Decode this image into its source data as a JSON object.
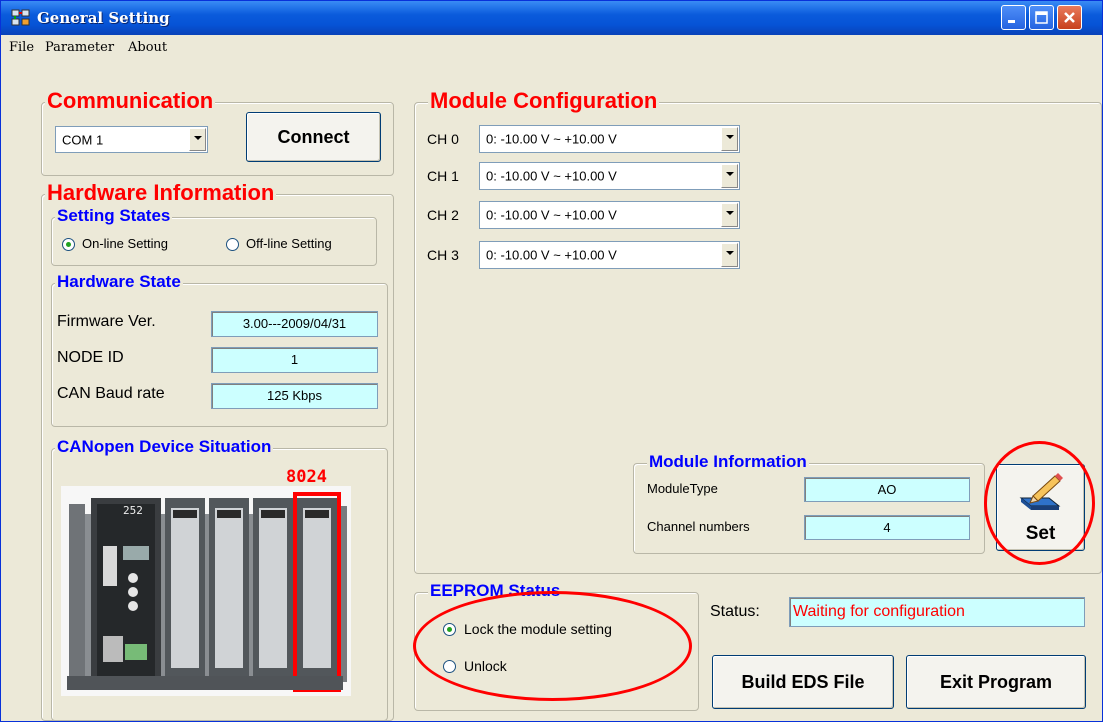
{
  "window": {
    "title": "General Setting"
  },
  "menu": {
    "file": "File",
    "parameter": "Parameter",
    "about": "About"
  },
  "communication": {
    "title": "Communication",
    "port_value": "COM 1",
    "connect_label": "Connect"
  },
  "hardware": {
    "title": "Hardware Information",
    "setting_states": {
      "title": "Setting States",
      "online_label": "On-line Setting",
      "offline_label": "Off-line Setting",
      "selected": "online"
    },
    "hardware_state": {
      "title": "Hardware State",
      "firmware_label": "Firmware Ver.",
      "firmware_value": "3.00---2009/04/31",
      "node_label": "NODE ID",
      "node_value": "1",
      "baud_label": "CAN Baud rate",
      "baud_value": "125  Kbps"
    },
    "device": {
      "title": "CANopen Device Situation",
      "module_label": "8024",
      "panel_text": "252"
    }
  },
  "module_config": {
    "title": "Module Configuration",
    "channels": [
      {
        "label": "CH 0",
        "value": "0: -10.00  V ~ +10.00  V"
      },
      {
        "label": "CH 1",
        "value": "0: -10.00  V ~ +10.00  V"
      },
      {
        "label": "CH 2",
        "value": "0: -10.00  V ~ +10.00  V"
      },
      {
        "label": "CH 3",
        "value": "0: -10.00  V ~ +10.00  V"
      }
    ]
  },
  "module_info": {
    "title": "Module Information",
    "type_label": "ModuleType",
    "type_value": "AO",
    "channels_label": "Channel numbers",
    "channels_value": "4"
  },
  "set_button": {
    "label": "Set",
    "icon": "pencil-tray-icon"
  },
  "eeprom": {
    "title": "EEPROM Status",
    "lock_label": "Lock the module setting",
    "unlock_label": "Unlock",
    "selected": "lock"
  },
  "status": {
    "label": "Status:",
    "value": "Waiting for configuration",
    "value_color": "#ff0000"
  },
  "actions": {
    "build_label": "Build EDS File",
    "exit_label": "Exit Program"
  },
  "colors": {
    "title_bar": "#0a5bdc",
    "red_header": "#ff0000",
    "blue_header": "#0000ff",
    "field_bg": "#ccffff",
    "highlight_circle": "#ff0000"
  }
}
